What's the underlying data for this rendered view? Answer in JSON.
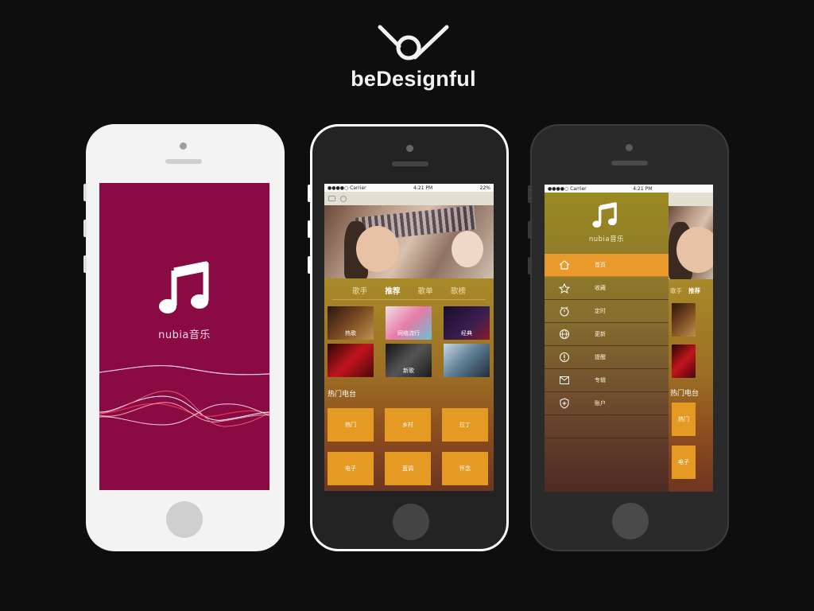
{
  "brand": {
    "name": "beDesignful"
  },
  "colors": {
    "splash": "#8a0a44",
    "accent": "#e99a2a",
    "gold": "#a88a28",
    "board": "#0e0e0e"
  },
  "splash": {
    "app_name": "nubia音乐",
    "icon": "music-note-icon"
  },
  "status_bar": {
    "carrier": "●●●●○ Carrier",
    "time": "4:21 PM",
    "battery": "22%",
    "wifi_icon": "wifi-icon",
    "battery_icon": "battery-icon"
  },
  "home": {
    "tabs": [
      {
        "label": "歌手",
        "active": false
      },
      {
        "label": "推荐",
        "active": true
      },
      {
        "label": "歌单",
        "active": false
      },
      {
        "label": "歌榜",
        "active": false
      }
    ],
    "albums": [
      {
        "label": "热歌"
      },
      {
        "label": "网络流行"
      },
      {
        "label": "经典"
      },
      {
        "label": ""
      },
      {
        "label": "新歌"
      },
      {
        "label": ""
      }
    ],
    "section_title": "热门电台",
    "genres": [
      "热门",
      "乡村",
      "拉丁",
      "电子",
      "蓝调",
      "怀念"
    ]
  },
  "drawer": {
    "app_name": "nubia音乐",
    "items": [
      {
        "label": "首页",
        "icon": "home-icon",
        "active": true
      },
      {
        "label": "收藏",
        "icon": "star-icon",
        "active": false
      },
      {
        "label": "定时",
        "icon": "timer-icon",
        "active": false
      },
      {
        "label": "更新",
        "icon": "globe-icon",
        "active": false
      },
      {
        "label": "提醒",
        "icon": "alert-icon",
        "active": false
      },
      {
        "label": "专辑",
        "icon": "mail-icon",
        "active": false
      },
      {
        "label": "账户",
        "icon": "shield-plus-icon",
        "active": false
      }
    ],
    "peek_tabs": [
      "歌手",
      "推荐"
    ],
    "peek_section": "热门电台",
    "peek_genres": [
      "热门",
      "电子"
    ]
  }
}
